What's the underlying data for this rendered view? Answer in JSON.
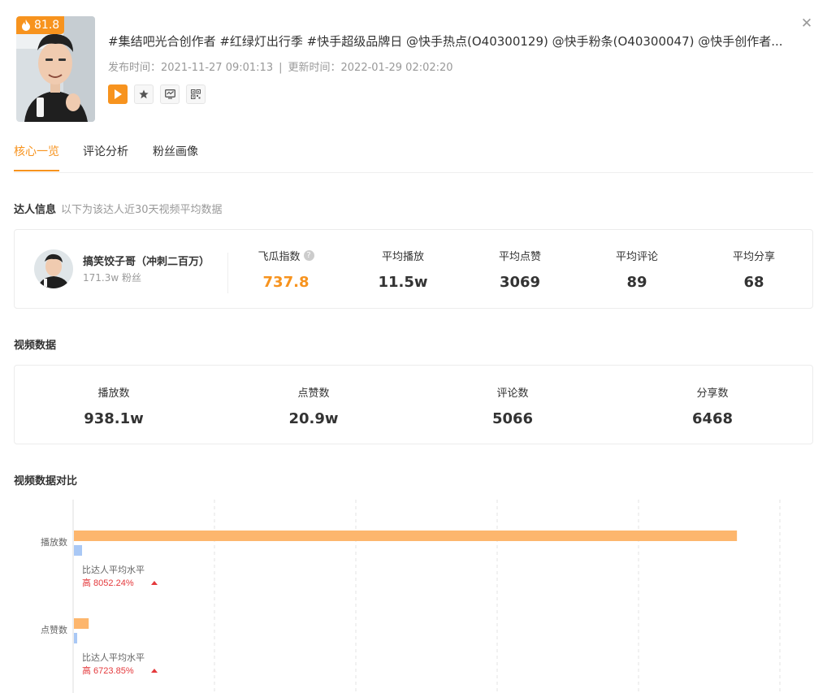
{
  "video": {
    "score": "81.8",
    "title": "#集结吧光合创作者 #红绿灯出行季 #快手超级品牌日 @快手热点(O40300129) @快手粉条(O40300047) @快手创作者...",
    "publish_label": "发布时间：",
    "publish_time": "2021-11-27 09:01:13",
    "separator": "|",
    "update_label": "更新时间：",
    "update_time": "2022-01-29 02:02:20"
  },
  "colors": {
    "accent": "#f7931e",
    "bar_video": "#fdb66d",
    "bar_avg": "#a9c8f5",
    "up": "#e4393c"
  },
  "tabs": [
    "核心一览",
    "评论分析",
    "粉丝画像"
  ],
  "kol_section": {
    "title": "达人信息",
    "subtitle": "以下为该达人近30天视频平均数据"
  },
  "kol": {
    "name": "搞笑饺子哥（冲刺二百万）",
    "fans": "171.3w 粉丝",
    "stats": [
      {
        "label": "飞瓜指数",
        "value": "737.8"
      },
      {
        "label": "平均播放",
        "value": "11.5w"
      },
      {
        "label": "平均点赞",
        "value": "3069"
      },
      {
        "label": "平均评论",
        "value": "89"
      },
      {
        "label": "平均分享",
        "value": "68"
      }
    ]
  },
  "video_section": {
    "title": "视频数据"
  },
  "video_stats": [
    {
      "label": "播放数",
      "value": "938.1w"
    },
    {
      "label": "点赞数",
      "value": "20.9w"
    },
    {
      "label": "评论数",
      "value": "5066"
    },
    {
      "label": "分享数",
      "value": "6468"
    }
  ],
  "compare_section": {
    "title": "视频数据对比"
  },
  "chart_data": {
    "type": "bar",
    "orientation": "horizontal",
    "categories": [
      "播放数",
      "点赞数"
    ],
    "series": [
      {
        "values": [
          938.1,
          20.9
        ]
      },
      {
        "values": [
          11.5,
          0.3069
        ]
      }
    ],
    "xlim": [
      0,
      1000
    ],
    "grid": "vertical-dashed",
    "annotations": [
      {
        "caption": "比达人平均水平",
        "text": "高 8052.24%"
      },
      {
        "caption": "比达人平均水平",
        "text": "高 6723.85%"
      }
    ]
  }
}
